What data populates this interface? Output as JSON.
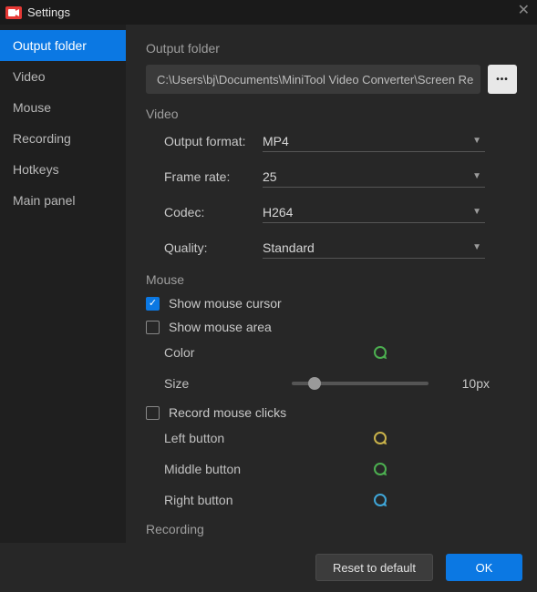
{
  "titlebar": {
    "title": "Settings"
  },
  "sidebar": {
    "items": [
      {
        "label": "Output folder"
      },
      {
        "label": "Video"
      },
      {
        "label": "Mouse"
      },
      {
        "label": "Recording"
      },
      {
        "label": "Hotkeys"
      },
      {
        "label": "Main panel"
      }
    ]
  },
  "sections": {
    "output": {
      "heading": "Output folder",
      "path": "C:\\Users\\bj\\Documents\\MiniTool Video Converter\\Screen Re"
    },
    "video": {
      "heading": "Video",
      "output_format_label": "Output format:",
      "output_format_value": "MP4",
      "frame_rate_label": "Frame rate:",
      "frame_rate_value": "25",
      "codec_label": "Codec:",
      "codec_value": "H264",
      "quality_label": "Quality:",
      "quality_value": "Standard"
    },
    "mouse": {
      "heading": "Mouse",
      "show_cursor": "Show mouse cursor",
      "show_area": "Show mouse area",
      "color_label": "Color",
      "size_label": "Size",
      "size_value": "10px",
      "record_clicks": "Record mouse clicks",
      "left": "Left button",
      "middle": "Middle button",
      "right": "Right button"
    },
    "recording": {
      "heading": "Recording"
    }
  },
  "footer": {
    "reset": "Reset to default",
    "ok": "OK"
  }
}
